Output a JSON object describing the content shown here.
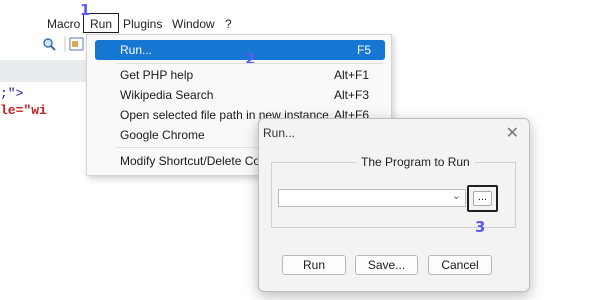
{
  "menubar": {
    "items": [
      "Macro",
      "Run",
      "Plugins",
      "Window",
      "?"
    ]
  },
  "steps": [
    "1",
    "2",
    "3"
  ],
  "editor": {
    "line1": ";\">",
    "line2": "le=\"wi"
  },
  "run_menu": {
    "items": [
      {
        "label": "Run...",
        "shortcut": "F5"
      },
      {
        "label": "Get PHP help",
        "shortcut": "Alt+F1"
      },
      {
        "label": "Wikipedia Search",
        "shortcut": "Alt+F3"
      },
      {
        "label": "Open selected file path in new instance",
        "shortcut": "Alt+F6"
      },
      {
        "label": "Google Chrome",
        "shortcut": ""
      },
      {
        "label": "Modify Shortcut/Delete Command...",
        "shortcut": ""
      }
    ]
  },
  "dialog": {
    "title": "Run...",
    "close": "✕",
    "group_label": "The Program to Run",
    "combo_value": "",
    "browse_label": "...",
    "buttons": {
      "run": "Run",
      "save": "Save...",
      "cancel": "Cancel"
    }
  },
  "colors": {
    "accent": "#1677d2",
    "step_marker": "#5b5bf0"
  }
}
